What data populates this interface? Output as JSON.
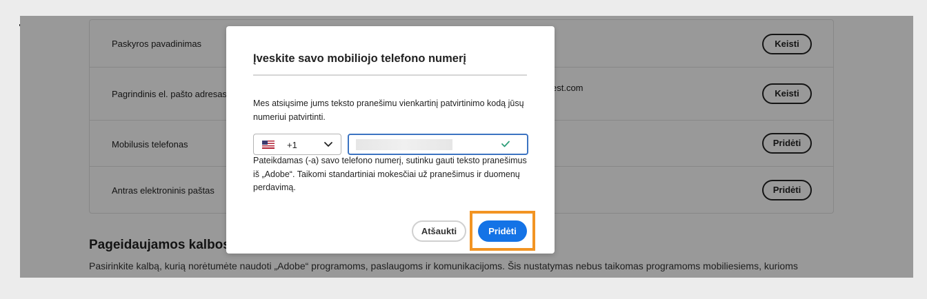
{
  "account": {
    "rows": [
      {
        "label": "Paskyros pavadinimas",
        "value": "",
        "button": "Keisti"
      },
      {
        "label": "Pagrindinis el. pašto adresas (",
        "value": "est.com",
        "button": "Keisti"
      },
      {
        "label": "Mobilusis telefonas",
        "value": "",
        "button": "Pridėti"
      },
      {
        "label": "Antras elektroninis paštas",
        "value": "",
        "button": "Pridėti"
      }
    ]
  },
  "languages": {
    "title": "Pageidaujamos kalbos",
    "description": "Pasirinkite kalbą, kurią norėtumėte naudoti „Adobe“ programoms, paslaugoms ir komunikacijoms. Šis nustatymas nebus taikomas programoms mobiliesiems, kurioms"
  },
  "modal": {
    "title": "Įveskite savo mobiliojo telefono numerį",
    "description": "Mes atsiųsime jums teksto pranešimu vienkartinį patvirtinimo kodą jūsų numeriui patvirtinti.",
    "country_code": "+1",
    "country_flag_icon": "us-flag-icon",
    "phone_value": "",
    "consent": "Pateikdamas (-a) savo telefono numerį, sutinku gauti teksto pranešimus iš „Adobe“. Taikomi standartiniai mokesčiai už pranešimus ir duomenų perdavimą.",
    "cancel_label": "Atšaukti",
    "submit_label": "Pridėti"
  },
  "colors": {
    "primary_button": "#1473e6",
    "highlight": "#f29423",
    "valid_check": "#2d9d78",
    "focus_border": "#3b73c1"
  }
}
